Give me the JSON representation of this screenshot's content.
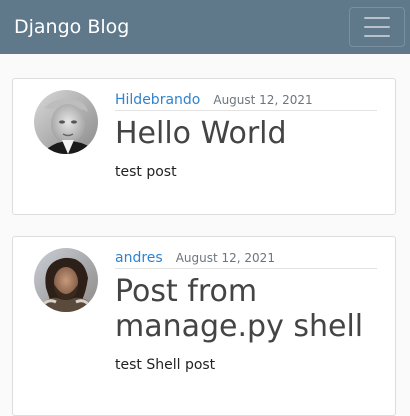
{
  "navbar": {
    "brand": "Django Blog",
    "toggler_icon": "hamburger-menu-icon"
  },
  "posts": [
    {
      "author": "Hildebrando",
      "date": "August 12, 2021",
      "title": "Hello World",
      "content": "test post"
    },
    {
      "author": "andres",
      "date": "August 12, 2021",
      "title": "Post from manage.py shell",
      "content": "test Shell post"
    }
  ],
  "colors": {
    "navbar_bg": "#5f788a",
    "link": "#2f83cf",
    "title": "#444444"
  }
}
